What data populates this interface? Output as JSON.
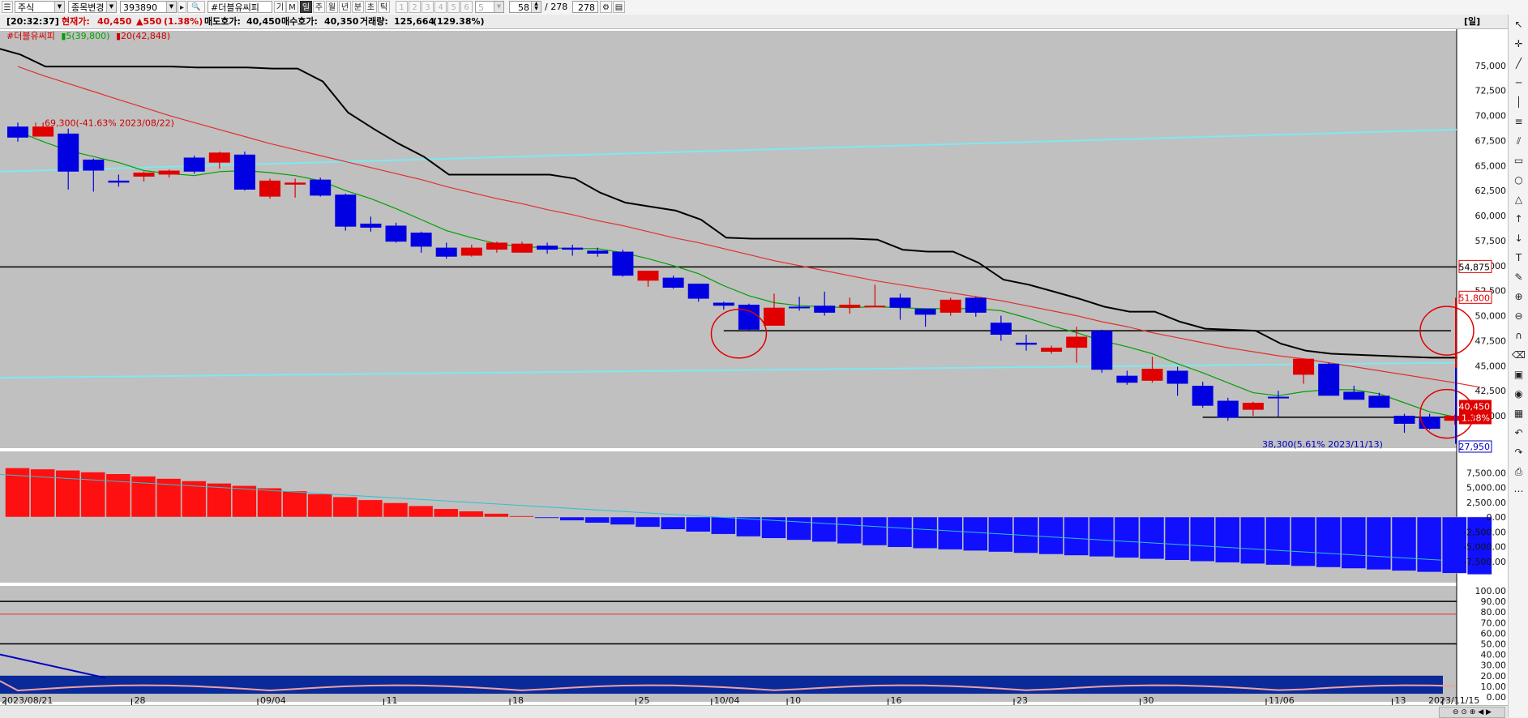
{
  "toolbar": {
    "market_type": "주식",
    "change_stock": "종목변경",
    "code": "393890",
    "stock_name": "#더블유씨피",
    "btn_ki": "기",
    "btn_m": "M",
    "periods": [
      "일",
      "주",
      "월",
      "년",
      "분",
      "초",
      "틱"
    ],
    "selected_period": "일",
    "minute_buttons": [
      "1",
      "2",
      "3",
      "4",
      "5",
      "6"
    ],
    "minute_value": "5",
    "visible_bars": "58",
    "total_label": "/ 278",
    "total_bars": "278"
  },
  "infobar": {
    "time": "[20:32:37]",
    "current_label": "현재가:",
    "current_price": "40,450",
    "change": "▲550",
    "change_pct": "(1.38%)",
    "ask_label": "매도호가:",
    "ask": "40,450",
    "bid_label": "매수호가:",
    "bid": "40,350",
    "volume_label": "거래량:",
    "volume": "125,664",
    "volume_pct": "(129.38%)",
    "period_badge": "[일]"
  },
  "legend": {
    "name": "#더블유씨피",
    "ma5": "5(39,800)",
    "ma20": "20(42,848)"
  },
  "annotations": {
    "high": "69,300(-41.63% 2023/08/22)",
    "low": "38,300(5.61% 2023/11/13)",
    "level_line": "54,875",
    "upper_mark": "51,800",
    "current_price": "40,450",
    "current_pct": "1.38%",
    "lower_mark": "27,950"
  },
  "colors": {
    "up": "#e00000",
    "down": "#0000e0",
    "ma5": "#00a000",
    "ma20": "#e03030",
    "cloud_line": "#000000",
    "trendline": "#7fe8f0",
    "pane_bg": "#c0c0c0"
  },
  "chart_data": [
    {
      "type": "candlestick",
      "ylim": [
        37250,
        77500
      ],
      "y_ticks": [
        "75,000",
        "72,500",
        "70,000",
        "67,500",
        "65,000",
        "62,500",
        "60,000",
        "57,500",
        "55,000",
        "52,500",
        "50,000",
        "47,500",
        "45,000",
        "42,500",
        "40,000"
      ],
      "x_labels": [
        "2023/08/21",
        "28",
        "09/04",
        "11",
        "18",
        "25",
        "10/04",
        "10",
        "16",
        "23",
        "30",
        "11/06",
        "13",
        "2023/11/15"
      ],
      "x_label_index": [
        0,
        5,
        10,
        15,
        20,
        25,
        28,
        31,
        35,
        40,
        45,
        50,
        55,
        57
      ],
      "candles": [
        {
          "o": 68900,
          "h": 69300,
          "l": 67400,
          "c": 67800
        },
        {
          "o": 67900,
          "h": 69300,
          "l": 68000,
          "c": 68900
        },
        {
          "o": 68200,
          "h": 68700,
          "l": 62600,
          "c": 64400
        },
        {
          "o": 65600,
          "h": 65700,
          "l": 62400,
          "c": 64500
        },
        {
          "o": 63500,
          "h": 64100,
          "l": 62900,
          "c": 63300
        },
        {
          "o": 63900,
          "h": 64400,
          "l": 63400,
          "c": 64300
        },
        {
          "o": 64100,
          "h": 64600,
          "l": 63800,
          "c": 64500
        },
        {
          "o": 65800,
          "h": 66000,
          "l": 64200,
          "c": 64400
        },
        {
          "o": 65300,
          "h": 66400,
          "l": 64700,
          "c": 66300
        },
        {
          "o": 66100,
          "h": 66400,
          "l": 62500,
          "c": 62600
        },
        {
          "o": 61900,
          "h": 63700,
          "l": 61700,
          "c": 63500
        },
        {
          "o": 63100,
          "h": 63700,
          "l": 61800,
          "c": 63300
        },
        {
          "o": 63600,
          "h": 63800,
          "l": 61900,
          "c": 62000
        },
        {
          "o": 62100,
          "h": 62200,
          "l": 58500,
          "c": 58900
        },
        {
          "o": 59200,
          "h": 59900,
          "l": 58400,
          "c": 58800
        },
        {
          "o": 59000,
          "h": 59300,
          "l": 57300,
          "c": 57400
        },
        {
          "o": 58300,
          "h": 58400,
          "l": 56300,
          "c": 56900
        },
        {
          "o": 56800,
          "h": 57300,
          "l": 55700,
          "c": 55900
        },
        {
          "o": 56000,
          "h": 57100,
          "l": 55900,
          "c": 56800
        },
        {
          "o": 56600,
          "h": 57400,
          "l": 56300,
          "c": 57300
        },
        {
          "o": 56300,
          "h": 57400,
          "l": 56300,
          "c": 57200
        },
        {
          "o": 57000,
          "h": 57300,
          "l": 56200,
          "c": 56600
        },
        {
          "o": 56800,
          "h": 57100,
          "l": 56000,
          "c": 56600
        },
        {
          "o": 56500,
          "h": 56800,
          "l": 55900,
          "c": 56200
        },
        {
          "o": 56400,
          "h": 56600,
          "l": 53900,
          "c": 54000
        },
        {
          "o": 53500,
          "h": 54200,
          "l": 52900,
          "c": 54500
        },
        {
          "o": 53800,
          "h": 54000,
          "l": 52700,
          "c": 52800
        },
        {
          "o": 53200,
          "h": 53200,
          "l": 51400,
          "c": 51700
        },
        {
          "o": 51300,
          "h": 51400,
          "l": 50600,
          "c": 51000
        },
        {
          "o": 51100,
          "h": 51200,
          "l": 48500,
          "c": 48600
        },
        {
          "o": 49000,
          "h": 52200,
          "l": 49000,
          "c": 50800
        },
        {
          "o": 50900,
          "h": 51900,
          "l": 50500,
          "c": 50800
        },
        {
          "o": 51000,
          "h": 52400,
          "l": 50000,
          "c": 50300
        },
        {
          "o": 50800,
          "h": 51800,
          "l": 50200,
          "c": 51100
        },
        {
          "o": 51000,
          "h": 53100,
          "l": 50900,
          "c": 51000
        },
        {
          "o": 51800,
          "h": 52200,
          "l": 49600,
          "c": 50800
        },
        {
          "o": 50700,
          "h": 50700,
          "l": 48900,
          "c": 50100
        },
        {
          "o": 50300,
          "h": 51800,
          "l": 50000,
          "c": 51600
        },
        {
          "o": 51800,
          "h": 51900,
          "l": 49900,
          "c": 50300
        },
        {
          "o": 49300,
          "h": 50000,
          "l": 47500,
          "c": 48100
        },
        {
          "o": 47300,
          "h": 48100,
          "l": 46500,
          "c": 47100
        },
        {
          "o": 46400,
          "h": 47000,
          "l": 46200,
          "c": 46800
        },
        {
          "o": 46800,
          "h": 48900,
          "l": 45300,
          "c": 47900
        },
        {
          "o": 48500,
          "h": 48600,
          "l": 44300,
          "c": 44600
        },
        {
          "o": 44000,
          "h": 44500,
          "l": 43100,
          "c": 43300
        },
        {
          "o": 43500,
          "h": 45900,
          "l": 43300,
          "c": 44700
        },
        {
          "o": 44500,
          "h": 44900,
          "l": 42000,
          "c": 43200
        },
        {
          "o": 43000,
          "h": 43400,
          "l": 40800,
          "c": 41000
        },
        {
          "o": 41500,
          "h": 41800,
          "l": 39500,
          "c": 39800
        },
        {
          "o": 40600,
          "h": 41400,
          "l": 40000,
          "c": 41300
        },
        {
          "o": 41900,
          "h": 42500,
          "l": 39900,
          "c": 41800
        },
        {
          "o": 44100,
          "h": 45500,
          "l": 43200,
          "c": 45700
        },
        {
          "o": 45200,
          "h": 45300,
          "l": 42100,
          "c": 42000
        },
        {
          "o": 42400,
          "h": 43000,
          "l": 41600,
          "c": 41600
        },
        {
          "o": 42000,
          "h": 42300,
          "l": 40800,
          "c": 40800
        },
        {
          "o": 40000,
          "h": 40200,
          "l": 38300,
          "c": 39200
        },
        {
          "o": 39900,
          "h": 40200,
          "l": 38600,
          "c": 38700
        },
        {
          "o": 39500,
          "h": 40100,
          "l": 39100,
          "c": 40000
        },
        {
          "o": 41200,
          "h": 41500,
          "l": 40100,
          "c": 40400
        }
      ],
      "ma5": [
        68400,
        67400,
        66500,
        65900,
        65300,
        64500,
        64200,
        64000,
        64400,
        64500,
        64300,
        64000,
        63500,
        62500,
        61700,
        60700,
        59600,
        58500,
        57800,
        57200,
        56900,
        56800,
        56700,
        56700,
        56300,
        55700,
        55000,
        54200,
        53000,
        52000,
        51300,
        51000,
        50900,
        50800,
        50900,
        50800,
        50700,
        50700,
        50700,
        50500,
        49800,
        49000,
        48300,
        47500,
        46900,
        46200,
        45200,
        44300,
        43300,
        42300,
        42000,
        42400,
        42600,
        42600,
        42200,
        41300,
        40400,
        39900,
        39800
      ],
      "ma20": [
        74900,
        74000,
        73200,
        72400,
        71600,
        70800,
        70000,
        69300,
        68600,
        67900,
        67200,
        66600,
        66000,
        65400,
        64800,
        64200,
        63600,
        62900,
        62300,
        61700,
        61200,
        60600,
        60100,
        59500,
        59000,
        58400,
        57800,
        57300,
        56700,
        56100,
        55500,
        55000,
        54500,
        54000,
        53500,
        53100,
        52700,
        52300,
        51900,
        51500,
        51000,
        50500,
        50000,
        49400,
        48900,
        48300,
        47800,
        47300,
        46800,
        46400,
        46000,
        45700,
        45300,
        44900,
        44500,
        44100,
        43700,
        43300,
        42848
      ]
    },
    {
      "type": "bar",
      "ylim": [
        -10000,
        10000
      ],
      "y_ticks": [
        "7,500.00",
        "5,000.00",
        "2,500.00",
        "0.00",
        "-2,500.00",
        "-5,000.00",
        "-7,500.00"
      ],
      "values": [
        8300,
        8100,
        7900,
        7600,
        7300,
        6900,
        6500,
        6100,
        5700,
        5300,
        4900,
        4400,
        3900,
        3400,
        2900,
        2400,
        1900,
        1400,
        1000,
        600,
        200,
        -200,
        -600,
        -1000,
        -1300,
        -1700,
        -2100,
        -2500,
        -2900,
        -3300,
        -3600,
        -3900,
        -4200,
        -4500,
        -4800,
        -5100,
        -5300,
        -5500,
        -5700,
        -5900,
        -6100,
        -6300,
        -6500,
        -6700,
        -6900,
        -7100,
        -7300,
        -7500,
        -7700,
        -7900,
        -8100,
        -8300,
        -8500,
        -8700,
        -8900,
        -9100,
        -9300,
        -9500,
        -9700
      ]
    },
    {
      "type": "line",
      "ylim": [
        0,
        100
      ],
      "y_ticks": [
        "100.00",
        "90.00",
        "80.00",
        "70.00",
        "60.00",
        "50.00",
        "40.00",
        "30.00",
        "20.00",
        "10.00",
        "0.00"
      ],
      "ref_lines": [
        90,
        78,
        50
      ]
    }
  ]
}
